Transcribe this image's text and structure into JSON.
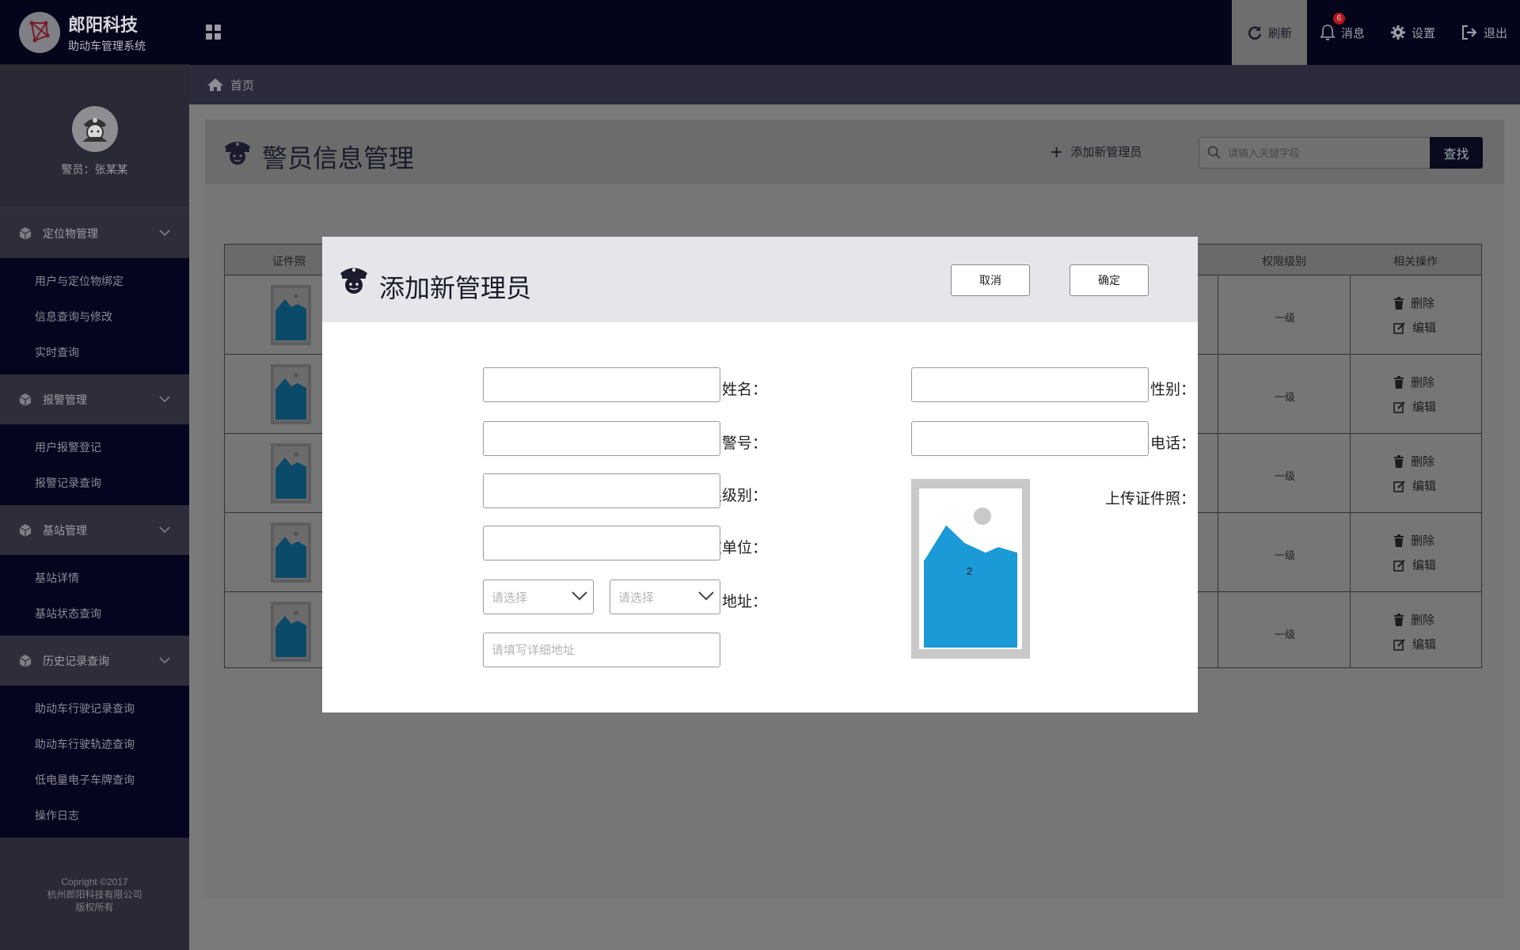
{
  "brand": {
    "title": "郎阳科技",
    "subtitle": "助动车管理系统"
  },
  "user": {
    "name": "警员：张某某"
  },
  "sidebar": {
    "groups": [
      {
        "label": "定位物管理",
        "items": [
          "用户与定位物绑定",
          "信息查询与修改",
          "实时查询"
        ]
      },
      {
        "label": "报警管理",
        "items": [
          "用户报警登记",
          "报警记录查询"
        ]
      },
      {
        "label": "基站管理",
        "items": [
          "基站详情",
          "基站状态查询"
        ]
      },
      {
        "label": "历史记录查询",
        "items": [
          "助动车行驶记录查询",
          "助动车行驶轨迹查询",
          "低电量电子车牌查询",
          "操作日志"
        ]
      }
    ],
    "copyright": [
      "Copright ©2017",
      "杭州郎阳科技有限公司",
      "版权所有"
    ]
  },
  "topbar": {
    "refresh": "刷新",
    "messages": "消息",
    "message_count": "6",
    "settings": "设置",
    "logout": "退出"
  },
  "breadcrumb": {
    "home": "首页"
  },
  "page": {
    "title": "警员信息管理",
    "add_button": "添加新管理员",
    "search_placeholder": "请输入关键字段",
    "search_button": "查找"
  },
  "table": {
    "headers": {
      "photo": "证件照",
      "level": "权限级别",
      "ops": "相关操作"
    },
    "rows": [
      {
        "level": "一级",
        "delete": "删除",
        "edit": "编辑"
      },
      {
        "level": "一级",
        "delete": "删除",
        "edit": "编辑"
      },
      {
        "level": "一级",
        "delete": "删除",
        "edit": "编辑"
      },
      {
        "level": "一级",
        "delete": "删除",
        "edit": "编辑"
      },
      {
        "level": "一级",
        "delete": "删除",
        "edit": "编辑"
      }
    ]
  },
  "modal": {
    "title": "添加新管理员",
    "cancel": "取消",
    "confirm": "确定",
    "fields": {
      "name": "姓名：",
      "gender": "性别：",
      "police_no": "警号：",
      "phone": "联系电话：",
      "level": "权限级别：",
      "unit": "所在单位：",
      "address": "地址：",
      "upload": "上传证件照："
    },
    "select_placeholder": "请选择",
    "address_placeholder": "请填写详细地址",
    "upload_count": "2"
  },
  "colors": {
    "dark_navy": "#04041a",
    "accent_blue": "#1a9ad6",
    "overlay_grey": "#767676"
  }
}
